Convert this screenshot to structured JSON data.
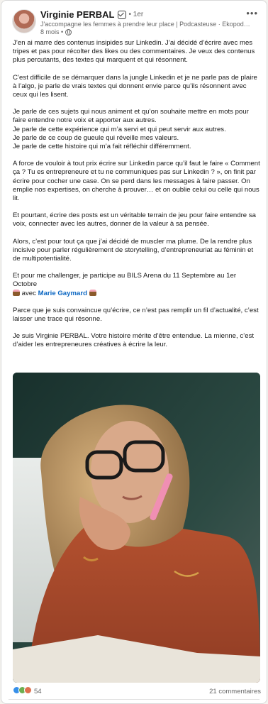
{
  "author": {
    "name": "Virginie PERBAL",
    "degree": "• 1er",
    "headline": "J'accompagne les femmes à prendre leur place | Podcasteuse · Ekopodcas…",
    "time": "8 mois •"
  },
  "icons": {
    "verified": "verified-icon",
    "globe": "globe-icon",
    "menu": "more-menu-icon"
  },
  "post": {
    "p1": "J’en ai marre des contenus insipides sur Linkedin. J’ai décidé d’écrire avec mes tripes et pas pour récolter des likes ou des commentaires. Je veux des contenus plus percutants, des textes qui marquent et qui résonnent.",
    "p2": "C’est difficile de se démarquer dans la jungle Linkedin et je ne parle pas de plaire à l’algo, je parle de vrais textes qui donnent envie parce qu’ils résonnent avec ceux qui les lisent.",
    "p3_l1": "Je parle de ces sujets qui nous animent et qu’on souhaite mettre en mots pour faire entendre notre voix et apporter aux autres.",
    "p3_l2": "Je parle de cette expérience qui m’a servi et qui peut servir aux autres.",
    "p3_l3": "Je parle de ce coup de gueule qui réveille mes valeurs.",
    "p3_l4": "Je parle de cette histoire qui m’a fait réfléchir différemment.",
    "p4": "A force de vouloir à tout prix écrire sur Linkedin parce qu’il faut le faire « Comment ça ? Tu es entrepreneure et tu ne communiques pas sur Linkedin ? », on finit par écrire pour cocher une case. On se perd dans les messages à faire passer. On emplie nos expertises, on cherche à prouver… et on oublie celui ou celle qui nous lit.",
    "p5": "Et pourtant, écrire des posts est un véritable terrain de jeu pour faire entendre sa voix, connecter avec les autres, donner de la valeur à sa pensée.",
    "p6": "Alors, c’est pour tout ça que j’ai décidé de muscler ma plume. De la rendre plus incisive pour parler régulièrement de storytelling, d’entrepreneuriat au féminin et de multipotentialité.",
    "p7_a": "Et pour me challenger, je participe au BILS Arena du 11 Septembre au 1er Octobre",
    "p7_b": "avec",
    "mention": "Marie Gaymard",
    "p8": "Parce que je suis convaincue qu’écrire, ce n’est pas remplir un fil d’actualité, c’est laisser une trace qui résonne.",
    "p9": "Je suis Virginie PERBAL. Votre histoire mérite d’être entendue. La mienne, c’est d’aider les entrepreneures créatives à écrire la leur."
  },
  "footer": {
    "reaction_count": "54",
    "comments": "21 commentaires"
  },
  "colors": {
    "mention": "#0a66c2",
    "like": "#378fe9",
    "celebrate": "#6dae4f",
    "love": "#df704d"
  }
}
